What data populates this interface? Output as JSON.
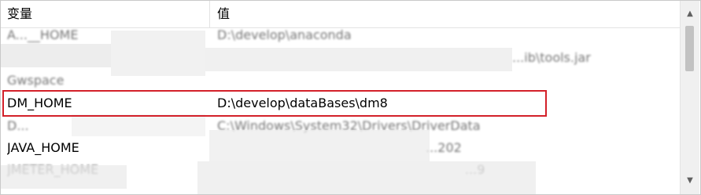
{
  "table": {
    "headers": {
      "variable": "变量",
      "value": "值"
    },
    "rows": [
      {
        "name": "A...__HOME",
        "value": "D:\\develop\\anaconda"
      },
      {
        "name": "",
        "value": "...ib\\tools.jar"
      },
      {
        "name": "Gwspace",
        "value": ""
      },
      {
        "name": "DM_HOME",
        "value": "D:\\develop\\dataBases\\dm8"
      },
      {
        "name": "D...",
        "value": "C:\\Windows\\System32\\Drivers\\DriverData"
      },
      {
        "name": "JAVA_HOME",
        "value": "...202"
      },
      {
        "name": "JMETER_HOME",
        "value": "...9"
      }
    ]
  },
  "highlight_color": "#d32029"
}
